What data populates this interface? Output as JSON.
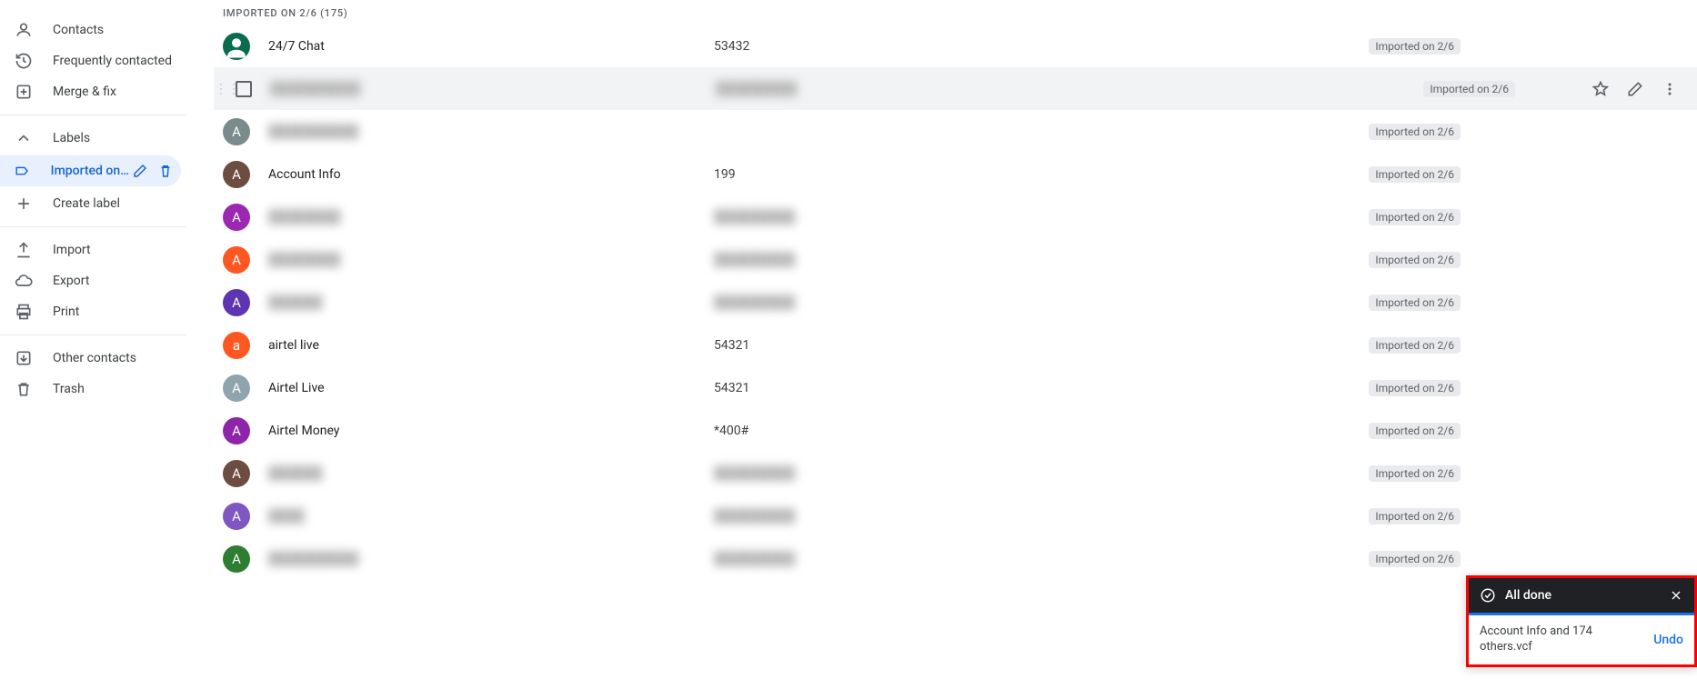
{
  "sidebar": {
    "contacts": "Contacts",
    "frequently": "Frequently contacted",
    "merge": "Merge & fix",
    "labels": "Labels",
    "active_label": "Imported on 2/6",
    "create_label": "Create label",
    "import": "Import",
    "export": "Export",
    "print": "Print",
    "other": "Other contacts",
    "trash": "Trash"
  },
  "list": {
    "header": "IMPORTED ON 2/6 (175)",
    "chip": "Imported on 2/6",
    "rows": [
      {
        "avatar_letter": "",
        "avatar_color": "#0b6b4f",
        "avatar_special": "person",
        "name": "24/7 Chat",
        "phone": "53432",
        "blur": false,
        "hovered": false
      },
      {
        "avatar_letter": "",
        "avatar_color": "",
        "avatar_special": "checkbox",
        "name": "██████████",
        "phone": "█████████",
        "blur": true,
        "hovered": true
      },
      {
        "avatar_letter": "A",
        "avatar_color": "#7b8a8b",
        "name": "██████████",
        "phone": "",
        "blur": true,
        "hovered": false
      },
      {
        "avatar_letter": "A",
        "avatar_color": "#6d4c41",
        "name": "Account Info",
        "phone": "199",
        "blur": false,
        "hovered": false
      },
      {
        "avatar_letter": "A",
        "avatar_color": "#9c27b0",
        "name": "████████",
        "phone": "█████████",
        "blur": true,
        "hovered": false
      },
      {
        "avatar_letter": "A",
        "avatar_color": "#ff5722",
        "name": "████████",
        "phone": "█████████",
        "blur": true,
        "hovered": false
      },
      {
        "avatar_letter": "A",
        "avatar_color": "#5e35b1",
        "name": "██████",
        "phone": "█████████",
        "blur": true,
        "hovered": false
      },
      {
        "avatar_letter": "a",
        "avatar_color": "#ff5722",
        "name": "airtel live",
        "phone": "54321",
        "blur": false,
        "hovered": false
      },
      {
        "avatar_letter": "A",
        "avatar_color": "#90a4ae",
        "name": "Airtel Live",
        "phone": "54321",
        "blur": false,
        "hovered": false
      },
      {
        "avatar_letter": "A",
        "avatar_color": "#8e24aa",
        "name": "Airtel Money",
        "phone": "*400#",
        "blur": false,
        "hovered": false
      },
      {
        "avatar_letter": "A",
        "avatar_color": "#6d4c41",
        "name": "██████",
        "phone": "█████████",
        "blur": true,
        "hovered": false
      },
      {
        "avatar_letter": "A",
        "avatar_color": "#7e57c2",
        "name": "████",
        "phone": "█████████",
        "blur": true,
        "hovered": false
      },
      {
        "avatar_letter": "A",
        "avatar_color": "#2e7d32",
        "name": "██████████",
        "phone": "█████████",
        "blur": true,
        "hovered": false
      }
    ]
  },
  "toast": {
    "title": "All done",
    "message": "Account Info and 174 others.vcf",
    "undo": "Undo"
  }
}
